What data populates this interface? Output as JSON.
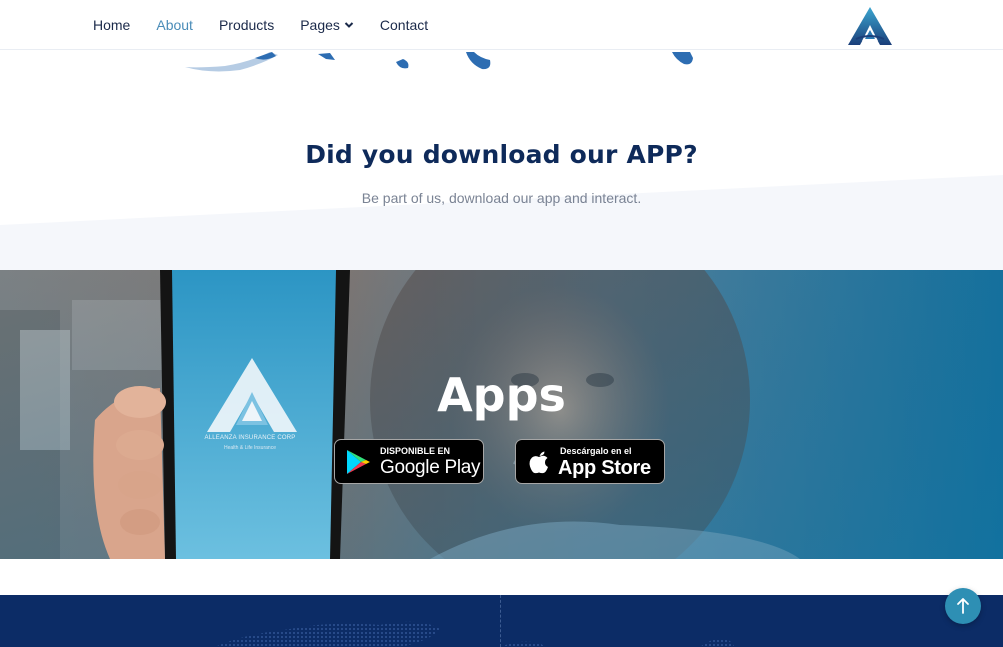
{
  "nav": {
    "links": [
      {
        "label": "Home",
        "active": false
      },
      {
        "label": "About",
        "active": true
      },
      {
        "label": "Products",
        "active": false
      },
      {
        "label": "Pages",
        "active": false,
        "has_dropdown": true
      },
      {
        "label": "Contact",
        "active": false
      }
    ],
    "logo_icon": "alleanza-logo-icon"
  },
  "download": {
    "title": "Did you download our APP?",
    "subtitle": "Be part of us, download our app and interact."
  },
  "apps": {
    "title": "Apps",
    "phone_brand": "ALLEANZA INSURANCE CORP",
    "phone_tagline": "Health & Life Insurance",
    "google_play": {
      "small": "DISPONIBLE EN",
      "big": "Google Play"
    },
    "app_store": {
      "small": "Descárgalo en el",
      "big": "App Store"
    }
  },
  "scroll_top": {
    "icon": "arrow-up-icon"
  },
  "colors": {
    "nav_text": "#1b2a4a",
    "nav_active": "#4a8cb8",
    "heading": "#0e2a5a",
    "subtitle": "#7a8394",
    "footer": "#0c2c66",
    "scroll_button": "#2e8fb4",
    "banner_teal": "#1f7fa6"
  }
}
